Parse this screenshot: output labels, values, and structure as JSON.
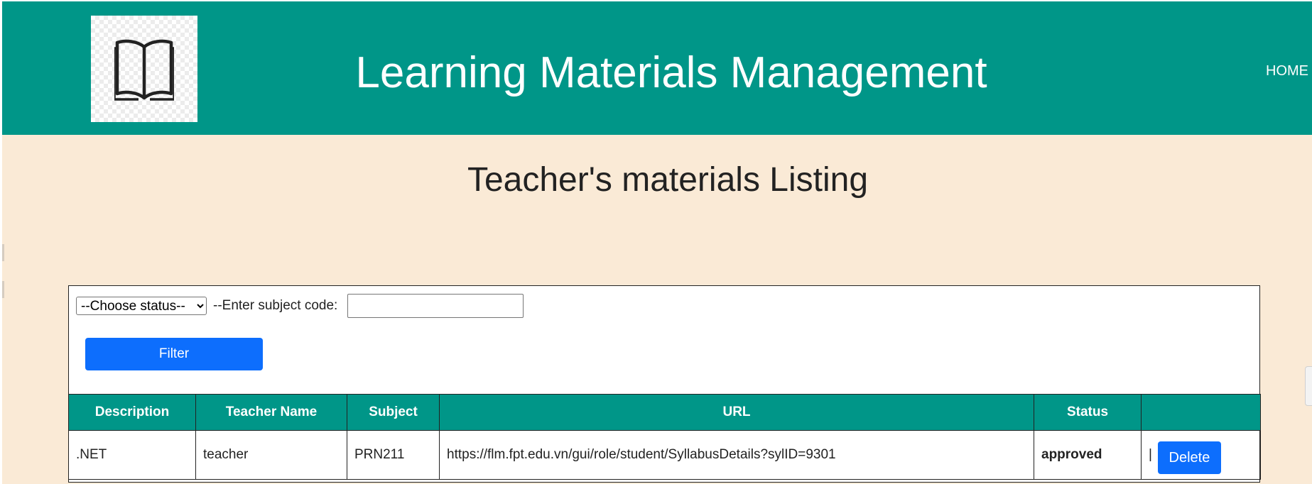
{
  "header": {
    "logo": "open-book-icon",
    "app_title": "Learning Materials Management",
    "nav_home": "HOME"
  },
  "page": {
    "title": "Teacher's materials Listing"
  },
  "filter": {
    "status_selected": "--Choose status--",
    "subject_label": "--Enter subject code:",
    "subject_value": "",
    "button_label": "Filter"
  },
  "table": {
    "columns": [
      "Description",
      "Teacher Name",
      "Subject",
      "URL",
      "Status",
      ""
    ],
    "rows": [
      {
        "description": ".NET",
        "teacher_name": "teacher",
        "subject": "PRN211",
        "url": "https://flm.fpt.edu.vn/gui/role/student/SyllabusDetails?sylID=9301",
        "status": "approved",
        "separator": "|",
        "action_label": "Delete"
      }
    ]
  },
  "colors": {
    "header_bg": "#009688",
    "page_bg": "#faead6",
    "button_primary": "#0d6efd",
    "status_approved": "#1e7b1e"
  }
}
